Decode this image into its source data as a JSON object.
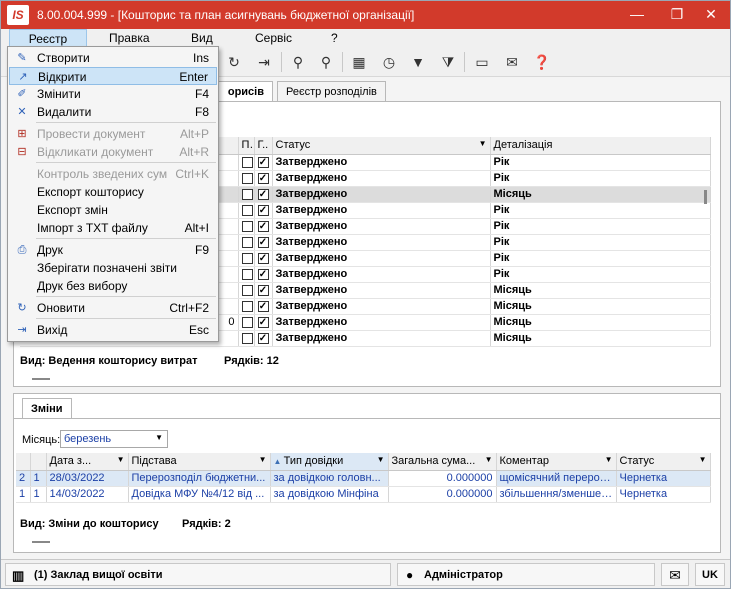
{
  "window": {
    "logo": "IS",
    "title": "8.00.004.999 - [Кошторис та план асигнувань бюджетної організації]",
    "minimize": "—",
    "restore": "❐",
    "close": "✕"
  },
  "menubar": [
    "Реєстр",
    "Правка",
    "Вид",
    "Сервіс",
    "?"
  ],
  "registry_menu": [
    {
      "label": "Створити",
      "key": "Ins",
      "icon": "create-icon",
      "state": "normal"
    },
    {
      "label": "Відкрити",
      "key": "Enter",
      "icon": "open-icon",
      "state": "highlighted"
    },
    {
      "label": "Змінити",
      "key": "F4",
      "icon": "edit-icon",
      "state": "normal"
    },
    {
      "label": "Видалити",
      "key": "F8",
      "icon": "delete-icon",
      "state": "normal"
    },
    {
      "label": "Провести документ",
      "key": "Alt+P",
      "icon": "post-document-icon",
      "state": "disabled"
    },
    {
      "label": "Відкликати документ",
      "key": "Alt+R",
      "icon": "revoke-document-icon",
      "state": "disabled"
    },
    {
      "label": "Контроль зведених сум",
      "key": "Ctrl+K",
      "icon": "",
      "state": "disabled"
    },
    {
      "label": "Експорт кошторису",
      "key": "",
      "icon": "",
      "state": "normal"
    },
    {
      "label": "Експорт змін",
      "key": "",
      "icon": "",
      "state": "normal"
    },
    {
      "label": "Імпорт з TXT файлу",
      "key": "Alt+I",
      "icon": "",
      "state": "normal"
    },
    {
      "label": "Друк",
      "key": "F9",
      "icon": "print-icon",
      "state": "normal"
    },
    {
      "label": "Зберігати позначені звіти",
      "key": "",
      "icon": "",
      "state": "normal"
    },
    {
      "label": "Друк без вибору",
      "key": "",
      "icon": "",
      "state": "normal"
    },
    {
      "label": "Оновити",
      "key": "Ctrl+F2",
      "icon": "refresh-icon",
      "state": "normal"
    },
    {
      "label": "Вихід",
      "key": "Esc",
      "icon": "exit-icon",
      "state": "normal"
    }
  ],
  "toolbar_icons": [
    "refresh-icon",
    "exit-icon",
    "search-icon",
    "search-next-icon",
    "grid-icon",
    "clock-icon",
    "export-icon",
    "filter-icon",
    "filter-clear-icon",
    "calculator-icon",
    "mail-icon",
    "help-icon"
  ],
  "top_tabs": [
    "орисів",
    "Реєстр розподілів"
  ],
  "top_grid": {
    "headers": {
      "c1": "П..",
      "c2": "Г..",
      "status": "Статус",
      "detail": "Деталізація"
    },
    "rows": [
      {
        "status": "Затверджено",
        "detail": "Рік"
      },
      {
        "status": "Затверджено",
        "detail": "Рік"
      },
      {
        "status": "Затверджено",
        "detail": "Місяць"
      },
      {
        "status": "Затверджено",
        "detail": "Рік"
      },
      {
        "status": "Затверджено",
        "detail": "Рік"
      },
      {
        "status": "Затверджено",
        "detail": "Рік"
      },
      {
        "status": "Затверджено",
        "detail": "Рік"
      },
      {
        "status": "Затверджено",
        "detail": "Рік"
      },
      {
        "status": "Затверджено",
        "detail": "Місяць"
      },
      {
        "status": "Затверджено",
        "detail": "Місяць"
      },
      {
        "status": "Затверджено",
        "detail": "Місяць"
      },
      {
        "status": "Затверджено",
        "detail": "Місяць"
      }
    ],
    "row_fragment": "0",
    "footer_view": "Вид: Ведення кошторису витрат",
    "footer_rows": "Рядків: 12"
  },
  "changes": {
    "tab": "Зміни",
    "month_label": "Місяць:",
    "month_value": "березень",
    "headers": [
      "",
      "",
      "Дата з...",
      "Підстава",
      "Тип довідки",
      "Загальна сума...",
      "Коментар",
      "Статус"
    ],
    "rows": [
      {
        "n": "2",
        "k": "1",
        "date": "28/03/2022",
        "basis": "Перерозподіл бюджетни...",
        "type": "за довідкою головн...",
        "sum": "0.000000",
        "comment": "щомісячний перероз...",
        "status": "Чернетка"
      },
      {
        "n": "1",
        "k": "1",
        "date": "14/03/2022",
        "basis": "Довідка МФУ №4/12 від ...",
        "type": "за довідкою Мінфіна",
        "sum": "0.000000",
        "comment": "збільшення/зменшен...",
        "status": "Чернетка"
      }
    ],
    "footer_view": "Вид: Зміни до кошторису",
    "footer_rows": "Рядків: 2"
  },
  "statusbar": {
    "org": "(1) Заклад вищої освіти",
    "user": "Адміністратор",
    "lang": "UK"
  }
}
